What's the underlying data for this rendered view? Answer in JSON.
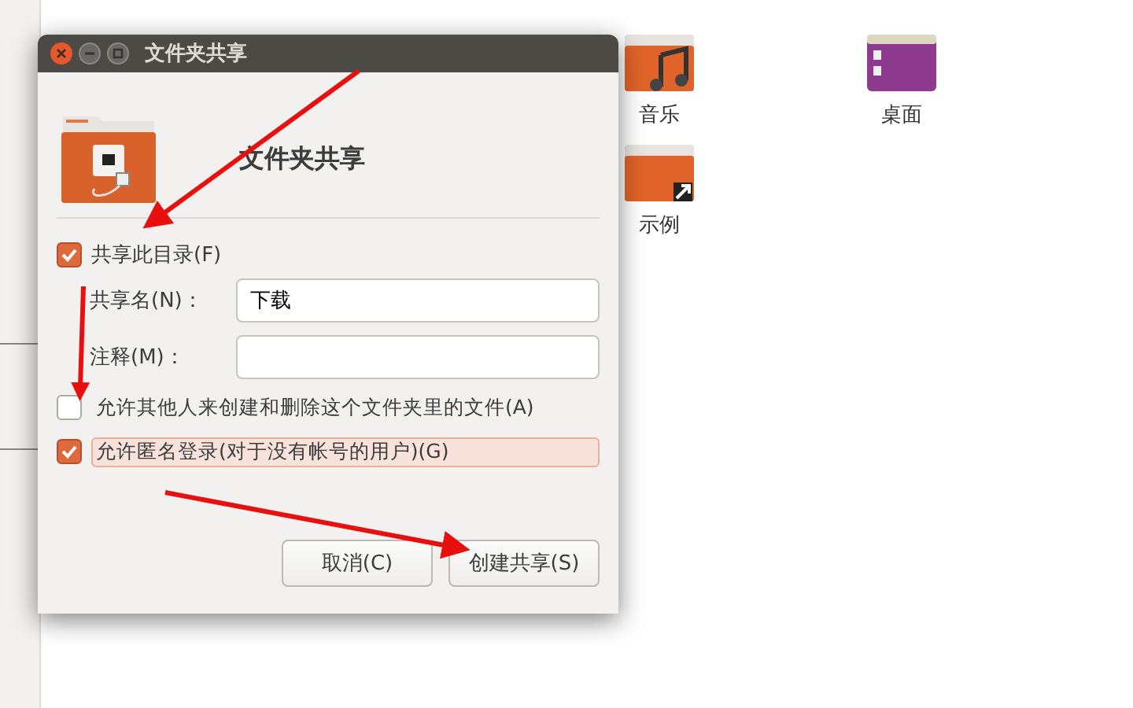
{
  "file_manager": {
    "items": [
      {
        "kind": "music",
        "label": "音乐"
      },
      {
        "kind": "desktop",
        "label": "桌面"
      },
      {
        "kind": "examples",
        "label": "示例"
      }
    ]
  },
  "dialog": {
    "title": "文件夹共享",
    "heading": "文件夹共享",
    "share_checkbox": {
      "label": "共享此目录(F)",
      "checked": true
    },
    "fields": [
      {
        "label": "共享名(N)：",
        "value": "下载"
      },
      {
        "label": "注释(M)："
      }
    ],
    "options": [
      {
        "label": "允许其他人来创建和删除这个文件夹里的文件(A)",
        "checked": false,
        "focused": false
      },
      {
        "label": "允许匿名登录(对于没有帐号的用户)(G)",
        "checked": true,
        "focused": true
      }
    ],
    "buttons": [
      {
        "label": "取消(C)"
      },
      {
        "label": "创建共享(S)"
      }
    ]
  }
}
